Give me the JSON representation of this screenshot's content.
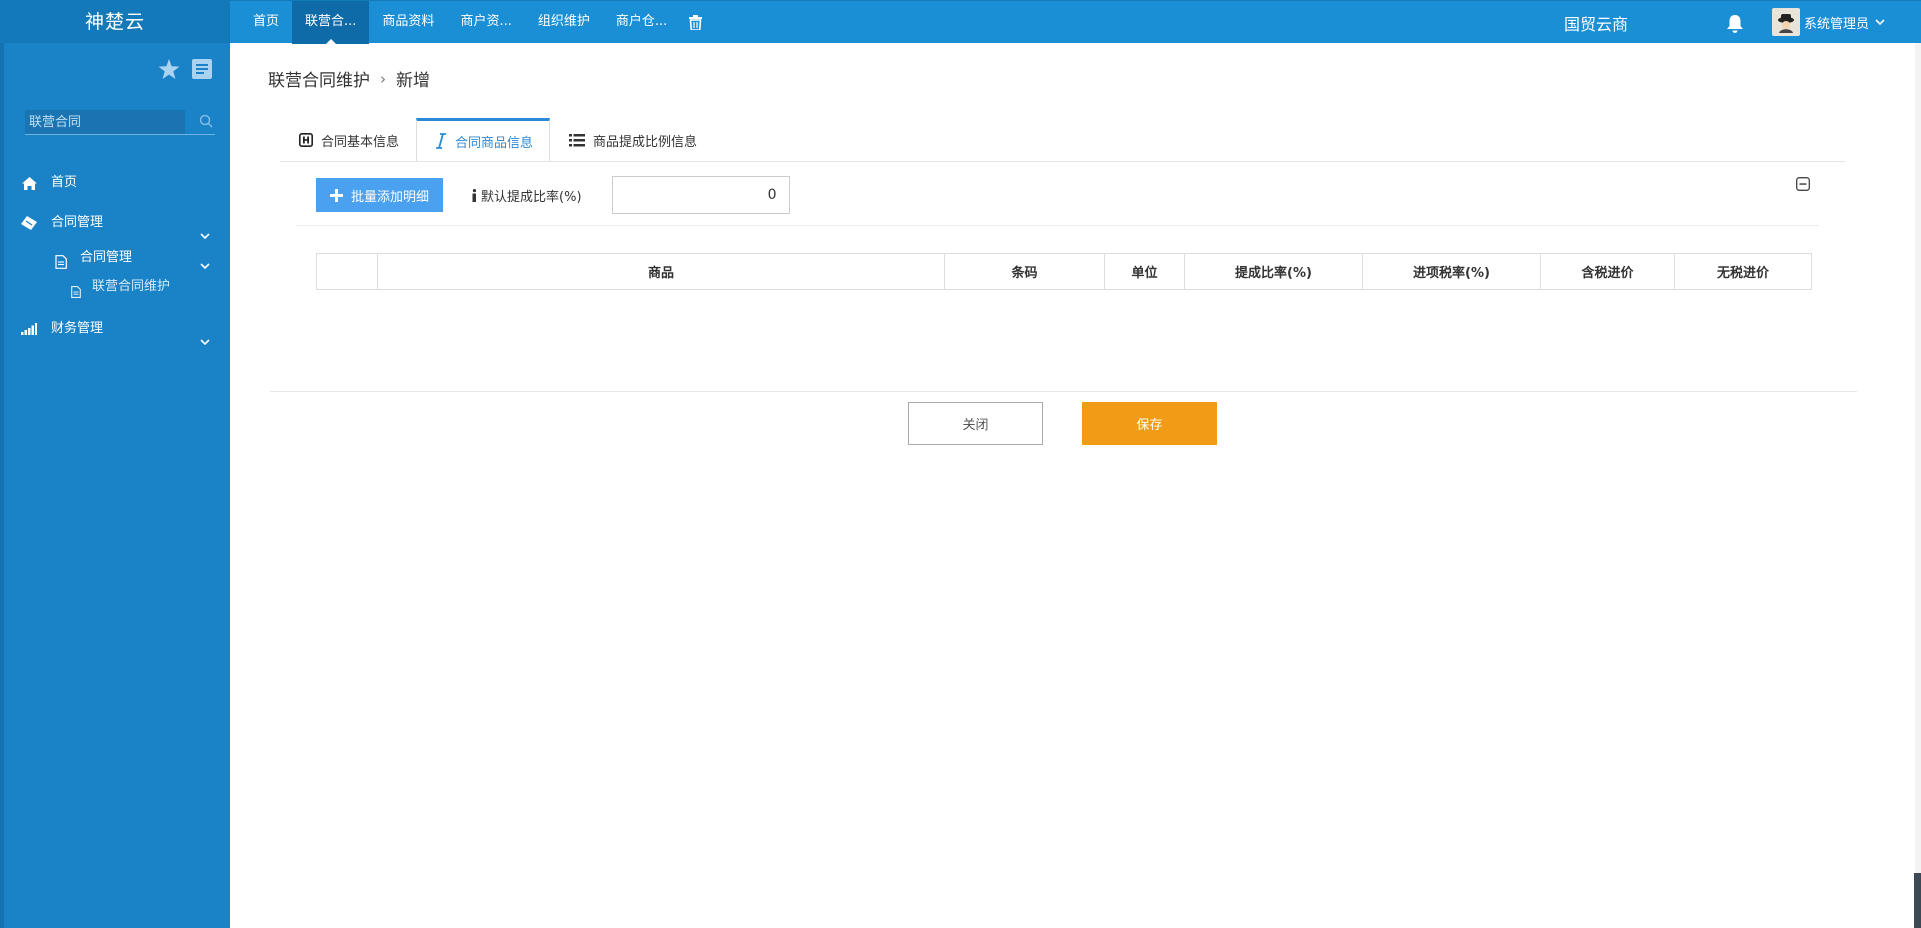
{
  "brand": "神楚云",
  "topnav": {
    "items": [
      {
        "label": "首页"
      },
      {
        "label": "联营合..."
      },
      {
        "label": "商品资料"
      },
      {
        "label": "商户资..."
      },
      {
        "label": "组织维护"
      },
      {
        "label": "商户仓..."
      }
    ],
    "active_index": 1,
    "org_name": "国贸云商",
    "user_name": "系统管理员"
  },
  "sidebar": {
    "search_placeholder": "联营合同",
    "menu": [
      {
        "label": "首页",
        "icon": "home-icon"
      },
      {
        "label": "合同管理",
        "icon": "ticket-icon"
      },
      {
        "label": "合同管理",
        "icon": "document-icon",
        "level": 2
      },
      {
        "label": "联营合同维护",
        "icon": "document-icon",
        "level": 3
      },
      {
        "label": "财务管理",
        "icon": "signal-bars-icon"
      }
    ]
  },
  "breadcrumb": {
    "parent": "联营合同维护",
    "separator": "›",
    "current": "新增"
  },
  "tabs": [
    {
      "label": "合同基本信息",
      "icon": "h-square-icon"
    },
    {
      "label": "合同商品信息",
      "icon": "italic-i-icon"
    },
    {
      "label": "商品提成比例信息",
      "icon": "list-icon"
    }
  ],
  "active_tab": 1,
  "toolbar": {
    "add_label": "批量添加明细",
    "rate_label": "默认提成比率(%)",
    "rate_value": "0"
  },
  "table": {
    "columns": [
      "",
      "商品",
      "条码",
      "单位",
      "提成比率(%)",
      "进项税率(%)",
      "含税进价",
      "无税进价"
    ],
    "rows": []
  },
  "footer": {
    "close_label": "关闭",
    "save_label": "保存"
  },
  "colors": {
    "topbar": "#1a8fd6",
    "sidebar": "#1a82c6",
    "accent": "#2a8ad8",
    "add_button": "#4aa1ef",
    "save_button": "#f19b16"
  }
}
